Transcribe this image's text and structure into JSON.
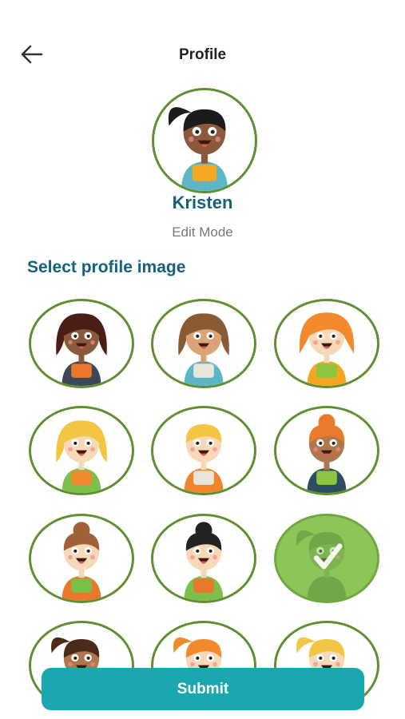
{
  "header": {
    "title": "Profile",
    "back_icon": "arrow-left-icon"
  },
  "profile": {
    "name": "Kristen",
    "mode": "Edit Mode"
  },
  "section": {
    "title": "Select profile image"
  },
  "submit": {
    "label": "Submit"
  },
  "colors": {
    "accent_green": "#5f8f32",
    "selected_fill": "#8cc65a",
    "title_blue": "#14607f",
    "button_teal": "#1aa7b0"
  },
  "avatars": [
    {
      "skin": "#8b5a3c",
      "hair": "#4a1e14",
      "shirt": "#e9782c",
      "bag": "#3d4758",
      "style": "long",
      "selected": false
    },
    {
      "skin": "#d9a575",
      "hair": "#8a5a34",
      "shirt": "#e9e5da",
      "bag": "#5bb7c6",
      "style": "long",
      "selected": false
    },
    {
      "skin": "#f7d9b8",
      "hair": "#f1892d",
      "shirt": "#8cc63f",
      "bag": "#f5a623",
      "style": "curly",
      "selected": false
    },
    {
      "skin": "#f7d9b8",
      "hair": "#f2c542",
      "shirt": "#f08a2d",
      "bag": "#7cc04a",
      "style": "long",
      "selected": false
    },
    {
      "skin": "#f7d9b8",
      "hair": "#f2c542",
      "shirt": "#e9e5da",
      "bag": "#f0852c",
      "style": "short",
      "selected": false
    },
    {
      "skin": "#b0774d",
      "hair": "#ea7a2c",
      "shirt": "#8cc63f",
      "bag": "#2f4d5e",
      "style": "bun",
      "selected": false
    },
    {
      "skin": "#f7d9b8",
      "hair": "#a0603a",
      "shirt": "#7cc04a",
      "bag": "#e9782c",
      "style": "bun",
      "selected": false
    },
    {
      "skin": "#f7d9b8",
      "hair": "#222222",
      "shirt": "#e9782c",
      "bag": "#7cc04a",
      "style": "bun",
      "selected": false
    },
    {
      "skin": "#6fa849",
      "hair": "#5b8f3a",
      "shirt": "#5b8f3a",
      "bag": "#5b8f3a",
      "style": "ponytail",
      "selected": true
    },
    {
      "skin": "#b0774d",
      "hair": "#4a2b1a",
      "shirt": "#e9782c",
      "bag": "#5bb7c6",
      "style": "ponytail",
      "selected": false
    },
    {
      "skin": "#f7d9b8",
      "hair": "#f1892d",
      "shirt": "#e9782c",
      "bag": "#8cc63f",
      "style": "ponytail",
      "selected": false
    },
    {
      "skin": "#f7d9b8",
      "hair": "#f2c542",
      "shirt": "#e9782c",
      "bag": "#8cc63f",
      "style": "ponytail",
      "selected": false
    }
  ],
  "main_avatar": {
    "skin": "#8b5a3c",
    "hair": "#1b1b1b",
    "shirt": "#f5a623",
    "bag": "#5bb7c6",
    "style": "ponytail"
  }
}
